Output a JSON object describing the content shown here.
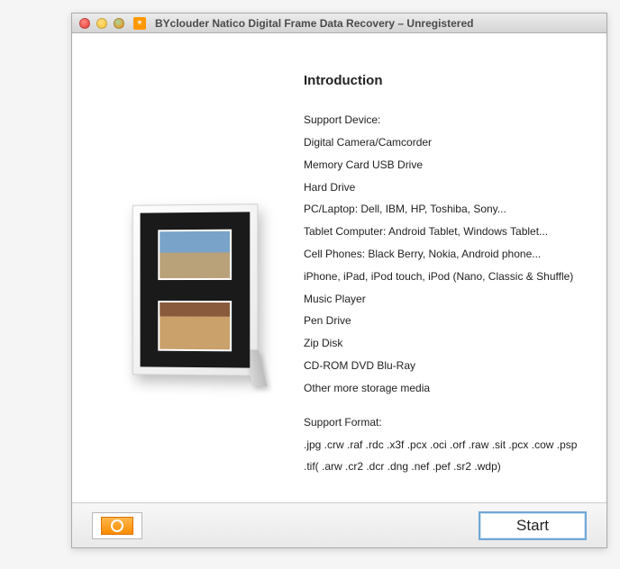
{
  "window": {
    "title": "BYclouder Natico Digital Frame Data Recovery – Unregistered"
  },
  "intro": {
    "heading": "Introduction",
    "support_device_label": "Support Device:",
    "devices": {
      "d1": "Digital Camera/Camcorder",
      "d2": "Memory Card USB Drive",
      "d3": "Hard Drive",
      "d4": "PC/Laptop: Dell, IBM, HP, Toshiba, Sony...",
      "d5": "Tablet Computer: Android Tablet, Windows Tablet...",
      "d6": "Cell Phones: Black Berry, Nokia, Android phone...",
      "d7": "iPhone, iPad, iPod touch, iPod (Nano, Classic & Shuffle)",
      "d8": "Music Player",
      "d9": "Pen Drive",
      "d10": "Zip Disk",
      "d11": "CD-ROM DVD Blu-Ray",
      "d12": "Other more storage media"
    },
    "support_format_label": "Support Format:",
    "formats": {
      "f1": ".jpg .crw .raf .rdc .x3f .pcx .oci .orf .raw .sit .pcx .cow .psp",
      "f2": ".tif( .arw .cr2 .dcr .dng .nef .pef .sr2 .wdp)"
    }
  },
  "buttons": {
    "start": "Start"
  }
}
